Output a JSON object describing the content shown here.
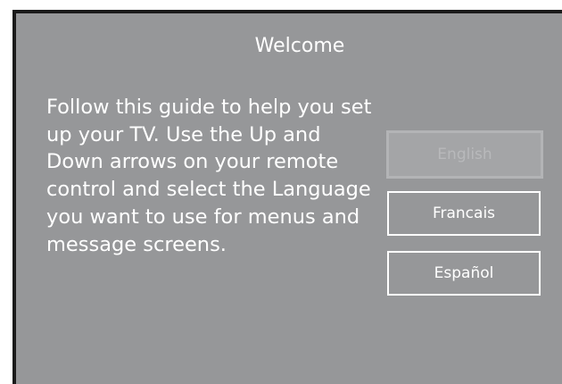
{
  "screen": {
    "title": "Welcome",
    "guide_text": "Follow this guide to help you set up your TV. Use the Up and Down arrows on your remote control and select the Language you want to use for menus and message screens."
  },
  "languages": [
    {
      "label": "English",
      "selected": true
    },
    {
      "label": "Francais",
      "selected": false
    },
    {
      "label": "Español",
      "selected": false
    }
  ],
  "colors": {
    "screen_background": "#969799",
    "text": "#ffffff",
    "selected_button_background": "#a4a5a7",
    "selected_button_text": "#b8b9bb",
    "frame": "#1a1a1a"
  }
}
